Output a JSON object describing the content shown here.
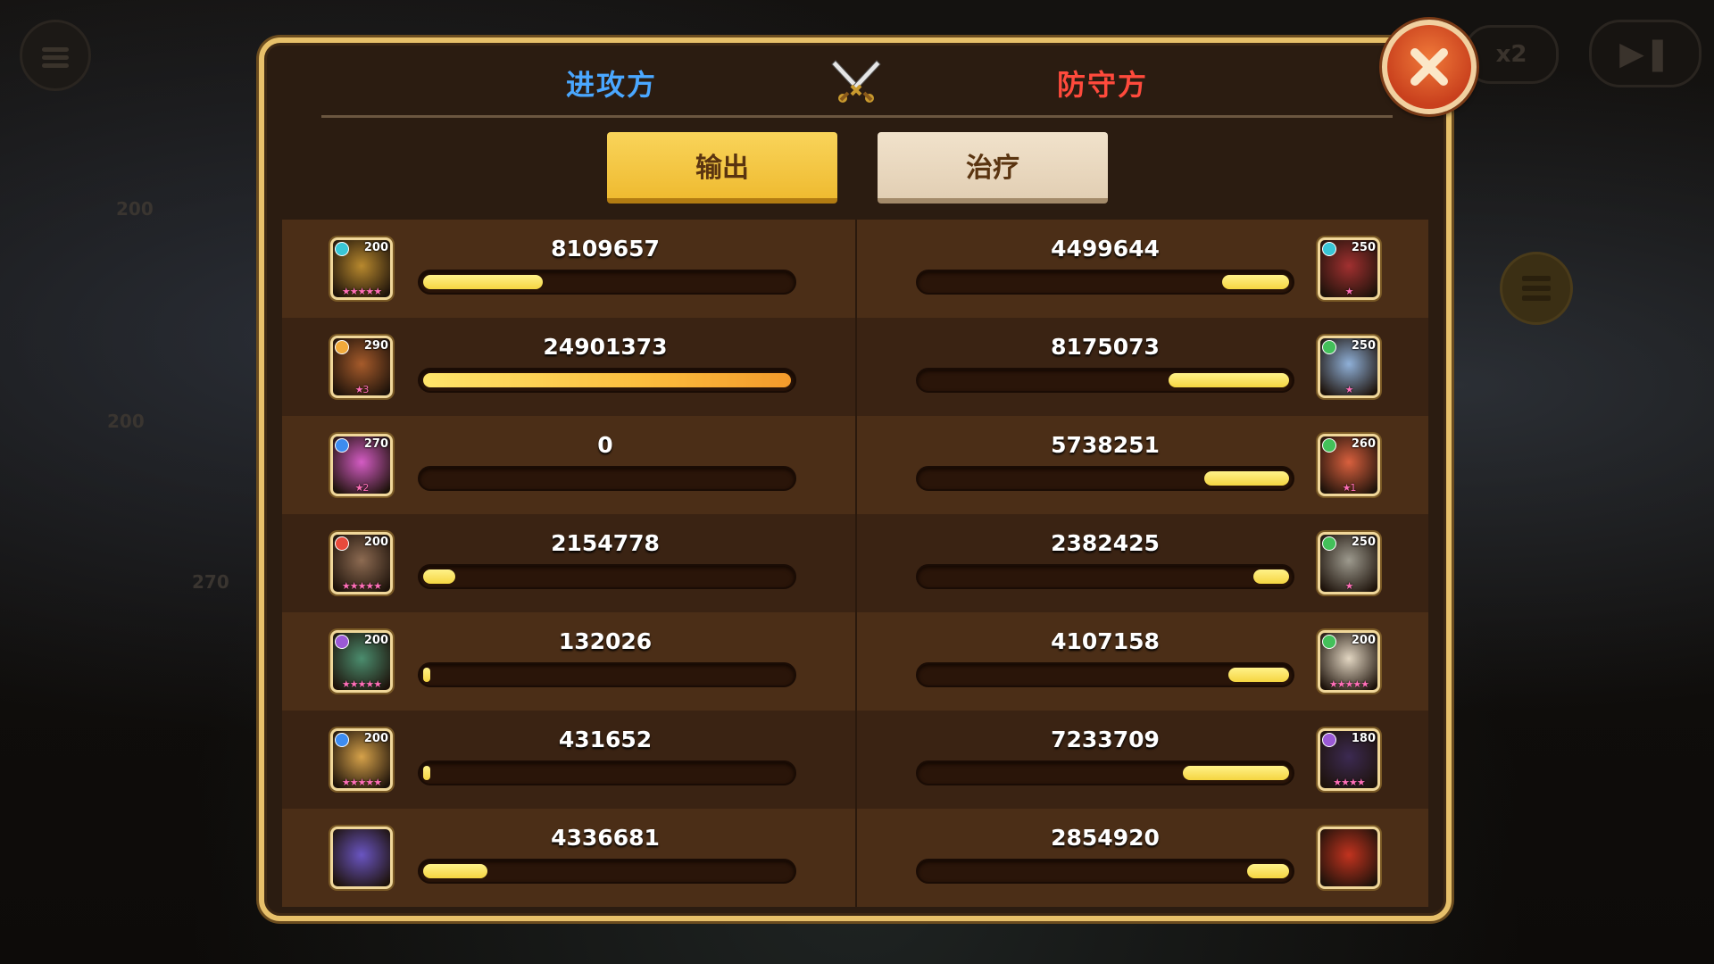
{
  "header": {
    "attacker_label": "进攻方",
    "defender_label": "防守方"
  },
  "tabs": [
    {
      "label": "输出",
      "active": true
    },
    {
      "label": "治疗",
      "active": false
    }
  ],
  "background": {
    "speed_label": "x2",
    "ghost_numbers": [
      "200",
      "200",
      "270"
    ]
  },
  "colors": {
    "attacker_title": "#4aa7ff",
    "defender_title": "#ff4a3c",
    "active_tab": "#f5c83d",
    "bar_fill": "#f5d541",
    "frame_gold": "#e7c06a"
  },
  "attackers": [
    {
      "value": "8109657",
      "level": "200",
      "element": "#39c6d6",
      "stars": "★★★★★",
      "portrait": "#b8892e",
      "fill": 0.326
    },
    {
      "value": "24901373",
      "level": "290",
      "element": "#f0a93b",
      "stars": "★3",
      "portrait": "#a65b2b",
      "fill": 1.0
    },
    {
      "value": "0",
      "level": "270",
      "element": "#3d8cf0",
      "stars": "★2",
      "portrait": "#d45cc4",
      "fill": 0.0
    },
    {
      "value": "2154778",
      "level": "200",
      "element": "#e84a3c",
      "stars": "★★★★★",
      "portrait": "#8d6b52",
      "fill": 0.087
    },
    {
      "value": "132026",
      "level": "200",
      "element": "#9b5ad6",
      "stars": "★★★★★",
      "portrait": "#4b8d6e",
      "fill": 0.005
    },
    {
      "value": "431652",
      "level": "200",
      "element": "#3d8cf0",
      "stars": "★★★★★",
      "portrait": "#d6a24a",
      "fill": 0.017
    },
    {
      "value": "4336681",
      "level": "",
      "element": "",
      "stars": "",
      "portrait": "#6a55c2",
      "fill": 0.174
    }
  ],
  "defenders": [
    {
      "value": "4499644",
      "level": "250",
      "element": "#39c6d6",
      "stars": "★",
      "portrait": "#a13030",
      "fill": 0.181
    },
    {
      "value": "8175073",
      "level": "250",
      "element": "#43c05a",
      "stars": "★",
      "portrait": "#8fb0d8",
      "fill": 0.328
    },
    {
      "value": "5738251",
      "level": "260",
      "element": "#43c05a",
      "stars": "★1",
      "portrait": "#d9603e",
      "fill": 0.23
    },
    {
      "value": "2382425",
      "level": "250",
      "element": "#43c05a",
      "stars": "★",
      "portrait": "#9d9a8e",
      "fill": 0.096
    },
    {
      "value": "4107158",
      "level": "200",
      "element": "#43c05a",
      "stars": "★★★★★",
      "portrait": "#e2d6c2",
      "fill": 0.165
    },
    {
      "value": "7233709",
      "level": "180",
      "element": "#9b5ad6",
      "stars": "★★★★",
      "portrait": "#3c2a52",
      "fill": 0.29
    },
    {
      "value": "2854920",
      "level": "",
      "element": "",
      "stars": "",
      "portrait": "#c2331f",
      "fill": 0.115
    }
  ]
}
